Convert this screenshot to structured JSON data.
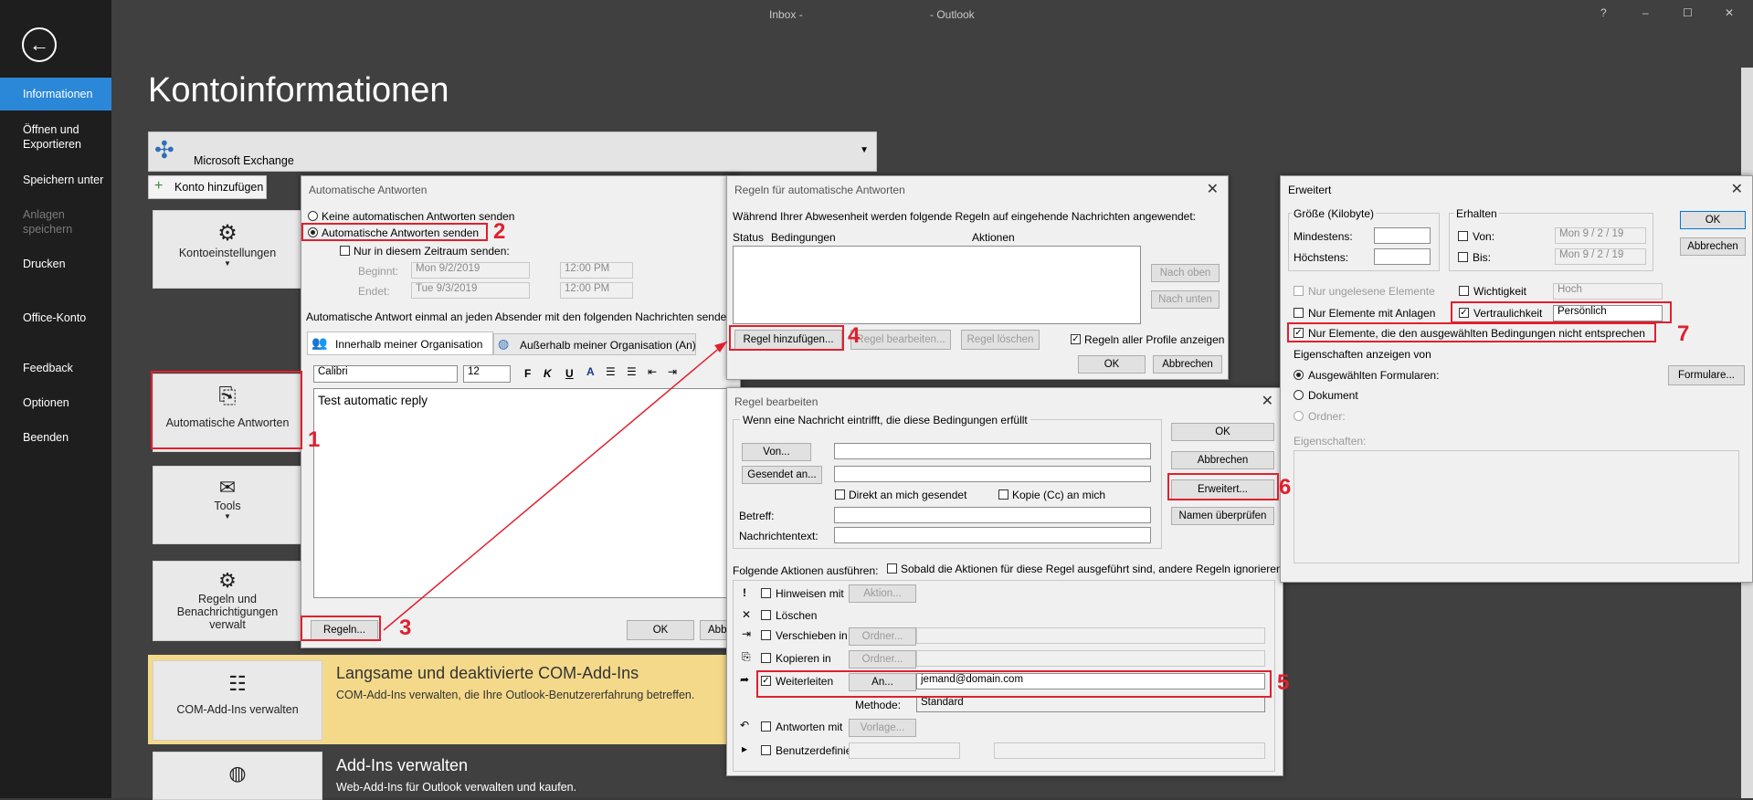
{
  "window": {
    "title_left": "Inbox -",
    "title_right": "- Outlook",
    "help": "?",
    "minimize": "–",
    "maximize": "☐",
    "close": "✕"
  },
  "nav": {
    "items": [
      "Informationen",
      "Öffnen und Exportieren",
      "Speichern unter",
      "Anlagen speichern",
      "Drucken",
      "Office-Konto",
      "Feedback",
      "Optionen",
      "Beenden"
    ]
  },
  "page": {
    "title": "Kontoinformationen",
    "account": "Microsoft Exchange",
    "add_account": "Konto hinzufügen",
    "tiles": {
      "settings": "Kontoeinstellungen",
      "auto": "Automatische Antworten",
      "tools": "Tools",
      "rules": "Regeln und Benachrichtigungen verwalt",
      "com": "COM-Add-Ins verwalten"
    },
    "com_title": "Langsame und deaktivierte COM-Add-Ins",
    "com_desc": "COM-Add-Ins verwalten, die Ihre Outlook-Benutzererfahrung betreffen.",
    "addins_title": "Add-Ins verwalten",
    "addins_desc": "Web-Add-Ins für Outlook verwalten und kaufen."
  },
  "auto_dlg": {
    "title": "Automatische Antworten",
    "none": "Keine automatischen Antworten senden",
    "send": "Automatische Antworten senden",
    "range": "Nur in diesem Zeitraum senden:",
    "begin_label": "Beginnt:",
    "end_label": "Endet:",
    "begin_date": "Mon 9/2/2019",
    "end_date": "Tue 9/3/2019",
    "begin_time": "12:00 PM",
    "end_time": "12:00 PM",
    "once": "Automatische Antwort einmal an jeden Absender mit den folgenden Nachrichten senden:",
    "tab_inside": "Innerhalb meiner Organisation",
    "tab_outside": "Außerhalb meiner Organisation (An)",
    "font": "Calibri",
    "size": "12",
    "body": "Test automatic reply",
    "rules_btn": "Regeln...",
    "ok": "OK",
    "cancel": "Abb"
  },
  "rules_dlg": {
    "title": "Regeln für automatische Antworten",
    "desc": "Während Ihrer Abwesenheit werden folgende Regeln auf eingehende Nachrichten angewendet:",
    "col_status": "Status",
    "col_cond": "Bedingungen",
    "col_actions": "Aktionen",
    "up": "Nach oben",
    "down": "Nach unten",
    "add": "Regel hinzufügen...",
    "edit": "Regel bearbeiten...",
    "delete": "Regel löschen",
    "all_profiles": "Regeln aller Profile anzeigen",
    "ok": "OK",
    "cancel": "Abbrechen"
  },
  "edit_dlg": {
    "title": "Regel bearbeiten",
    "group": "Wenn eine Nachricht eintrifft, die diese Bedingungen erfüllt",
    "from": "Von...",
    "sent_to": "Gesendet an...",
    "direct": "Direkt an mich gesendet",
    "cc": "Kopie (Cc) an mich",
    "subject": "Betreff:",
    "body": "Nachrichtentext:",
    "ok": "OK",
    "cancel": "Abbrechen",
    "advanced": "Erweitert...",
    "check_names": "Namen überprüfen",
    "actions_label": "Folgende Aktionen ausführen:",
    "stop": "Sobald die Aktionen für diese Regel ausgeführt sind, andere Regeln ignorieren",
    "actions": [
      {
        "icon": "!",
        "label": "Hinweisen mit",
        "btn": "Aktion..."
      },
      {
        "icon": "✕",
        "label": "Löschen",
        "btn": ""
      },
      {
        "icon": "⇥",
        "label": "Verschieben in",
        "btn": "Ordner..."
      },
      {
        "icon": "⎘",
        "label": "Kopieren in",
        "btn": "Ordner..."
      },
      {
        "icon": "➦",
        "label": "Weiterleiten",
        "btn": "An..."
      },
      {
        "icon": "↶",
        "label": "Antworten mit",
        "btn": "Vorlage..."
      },
      {
        "icon": "▸",
        "label": "Benutzerdefiniert",
        "btn": ""
      }
    ],
    "forward_to": "jemand@domain.com",
    "method_label": "Methode:",
    "method": "Standard"
  },
  "adv_dlg": {
    "title": "Erweitert",
    "size_group": "Größe (Kilobyte)",
    "min": "Mindestens:",
    "max": "Höchstens:",
    "received_group": "Erhalten",
    "from": "Von:",
    "to": "Bis:",
    "date1": "Mon   9 / 2 / 19",
    "date2": "Mon   9 / 2 / 19",
    "ok": "OK",
    "cancel": "Abbrechen",
    "unread": "Nur ungelesene Elemente",
    "attach": "Nur Elemente mit Anlagen",
    "importance": "Wichtigkeit",
    "importance_val": "Hoch",
    "sensitivity": "Vertraulichkeit",
    "sensitivity_val": "Persönlich",
    "not_match": "Nur Elemente, die den ausgewählten Bedingungen nicht entsprechen",
    "props_group": "Eigenschaften anzeigen von",
    "selected_forms": "Ausgewählten Formularen:",
    "forms_btn": "Formulare...",
    "document": "Dokument",
    "folder": "Ordner:",
    "properties": "Eigenschaften:"
  },
  "annotations": [
    "1",
    "2",
    "3",
    "4",
    "5",
    "6",
    "7"
  ],
  "colors": {
    "accent": "#2b88d8",
    "annotation": "#e0202e",
    "backstage": "#1e1e1e",
    "highlight": "#f4d98a"
  }
}
